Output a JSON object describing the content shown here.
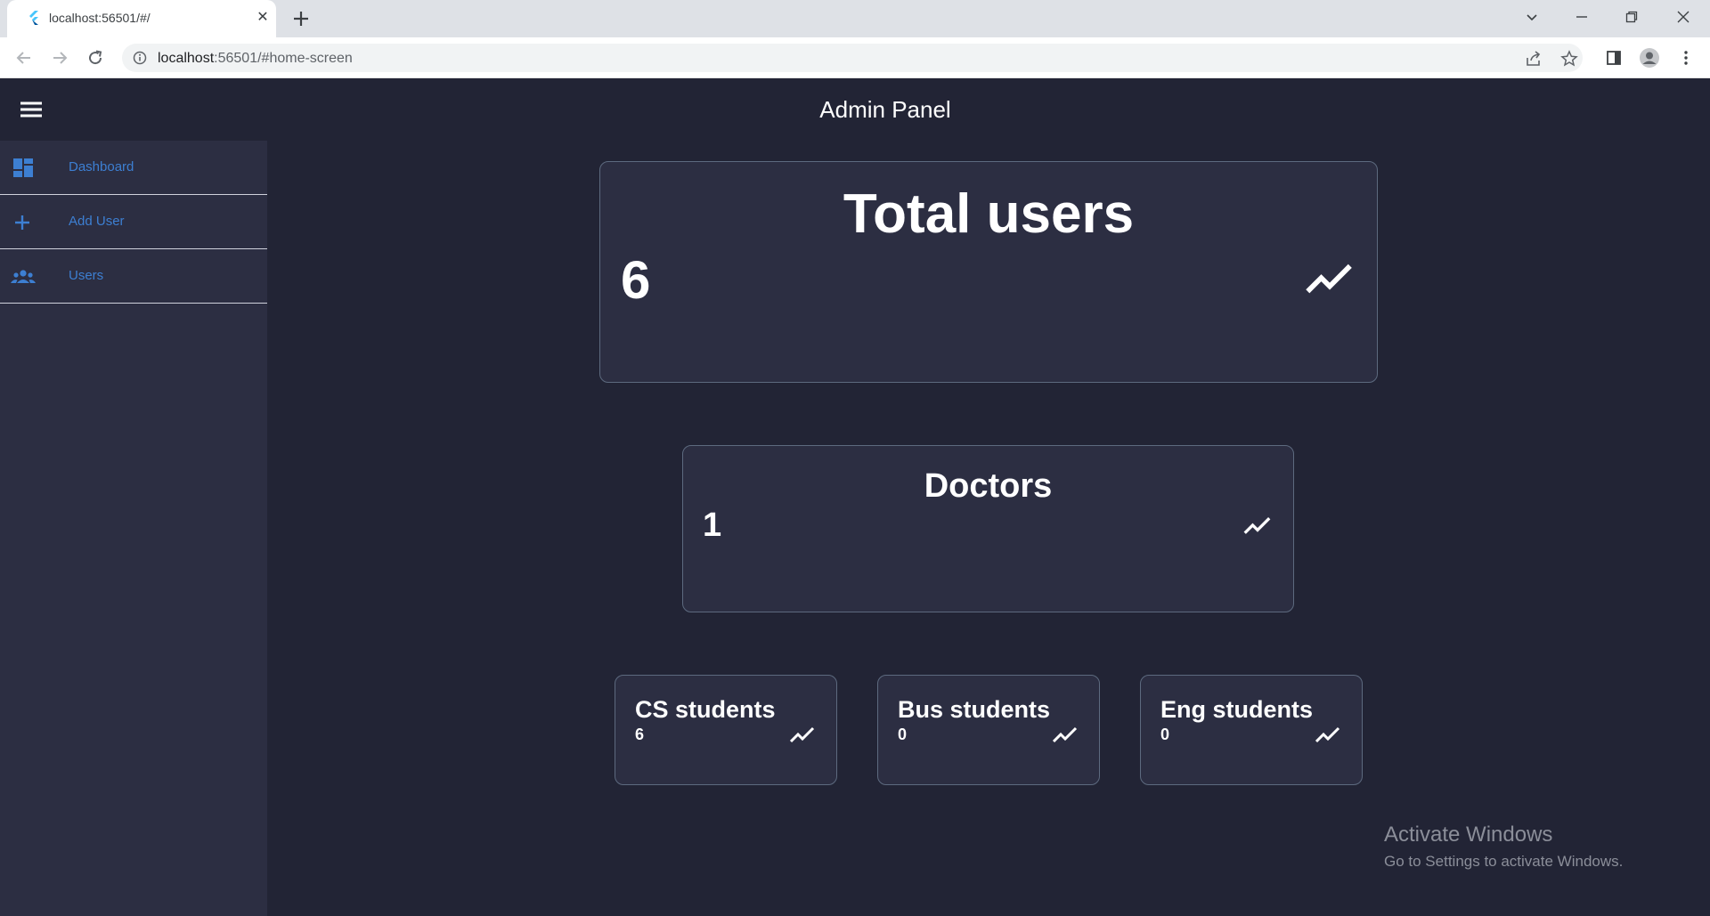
{
  "browser": {
    "tab_title": "localhost:56501/#/",
    "url_host": "localhost",
    "url_rest": ":56501/#home-screen"
  },
  "app": {
    "title": "Admin Panel"
  },
  "sidebar": {
    "items": [
      {
        "label": "Dashboard",
        "icon": "dashboard-icon"
      },
      {
        "label": "Add User",
        "icon": "plus-icon"
      },
      {
        "label": "Users",
        "icon": "group-icon"
      }
    ]
  },
  "stats": {
    "total_users": {
      "title": "Total users",
      "value": "6"
    },
    "doctors": {
      "title": "Doctors",
      "value": "1"
    },
    "cs_students": {
      "title": "CS students",
      "value": "6"
    },
    "bus_students": {
      "title": "Bus students",
      "value": "0"
    },
    "eng_students": {
      "title": "Eng students",
      "value": "0"
    }
  },
  "watermark": {
    "line1": "Activate Windows",
    "line2": "Go to Settings to activate Windows."
  },
  "colors": {
    "background": "#222435",
    "sidebar": "#2c2e42",
    "accent": "#3d7fd2",
    "card_border": "#5d6a7f"
  }
}
